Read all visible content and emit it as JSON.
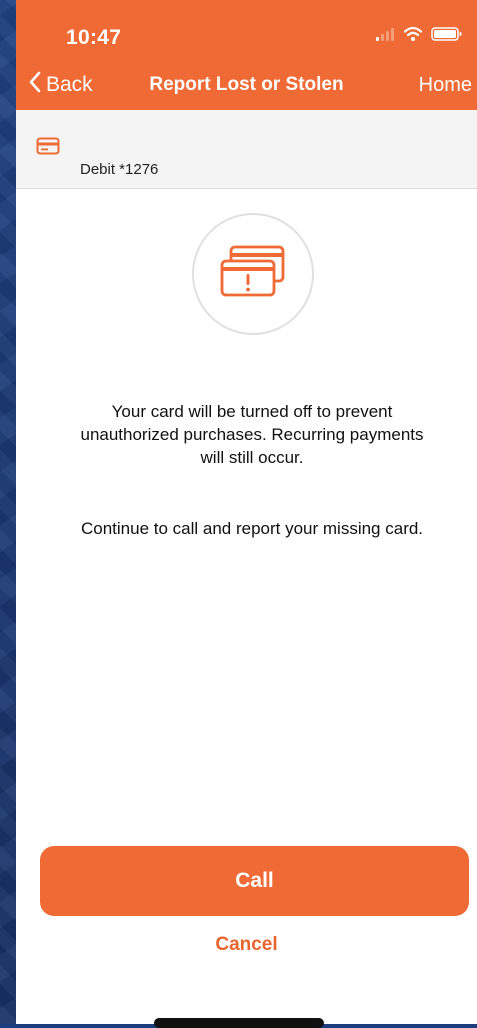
{
  "status_bar": {
    "time": "10:47"
  },
  "nav": {
    "back_label": "Back",
    "title": "Report Lost or Stolen",
    "home_label": "Home"
  },
  "account": {
    "label": "Debit *1276",
    "icon": "credit-card-icon"
  },
  "alert": {
    "icon": "card-alert-icon"
  },
  "messages": {
    "info": "Your card will be turned off to prevent unauthorized purchases. Recurring payments will still occur.",
    "instruction": "Continue to call and report your missing card."
  },
  "actions": {
    "call_label": "Call",
    "cancel_label": "Cancel"
  },
  "colors": {
    "accent": "#ef6a35",
    "background": "#1d3e7e"
  }
}
